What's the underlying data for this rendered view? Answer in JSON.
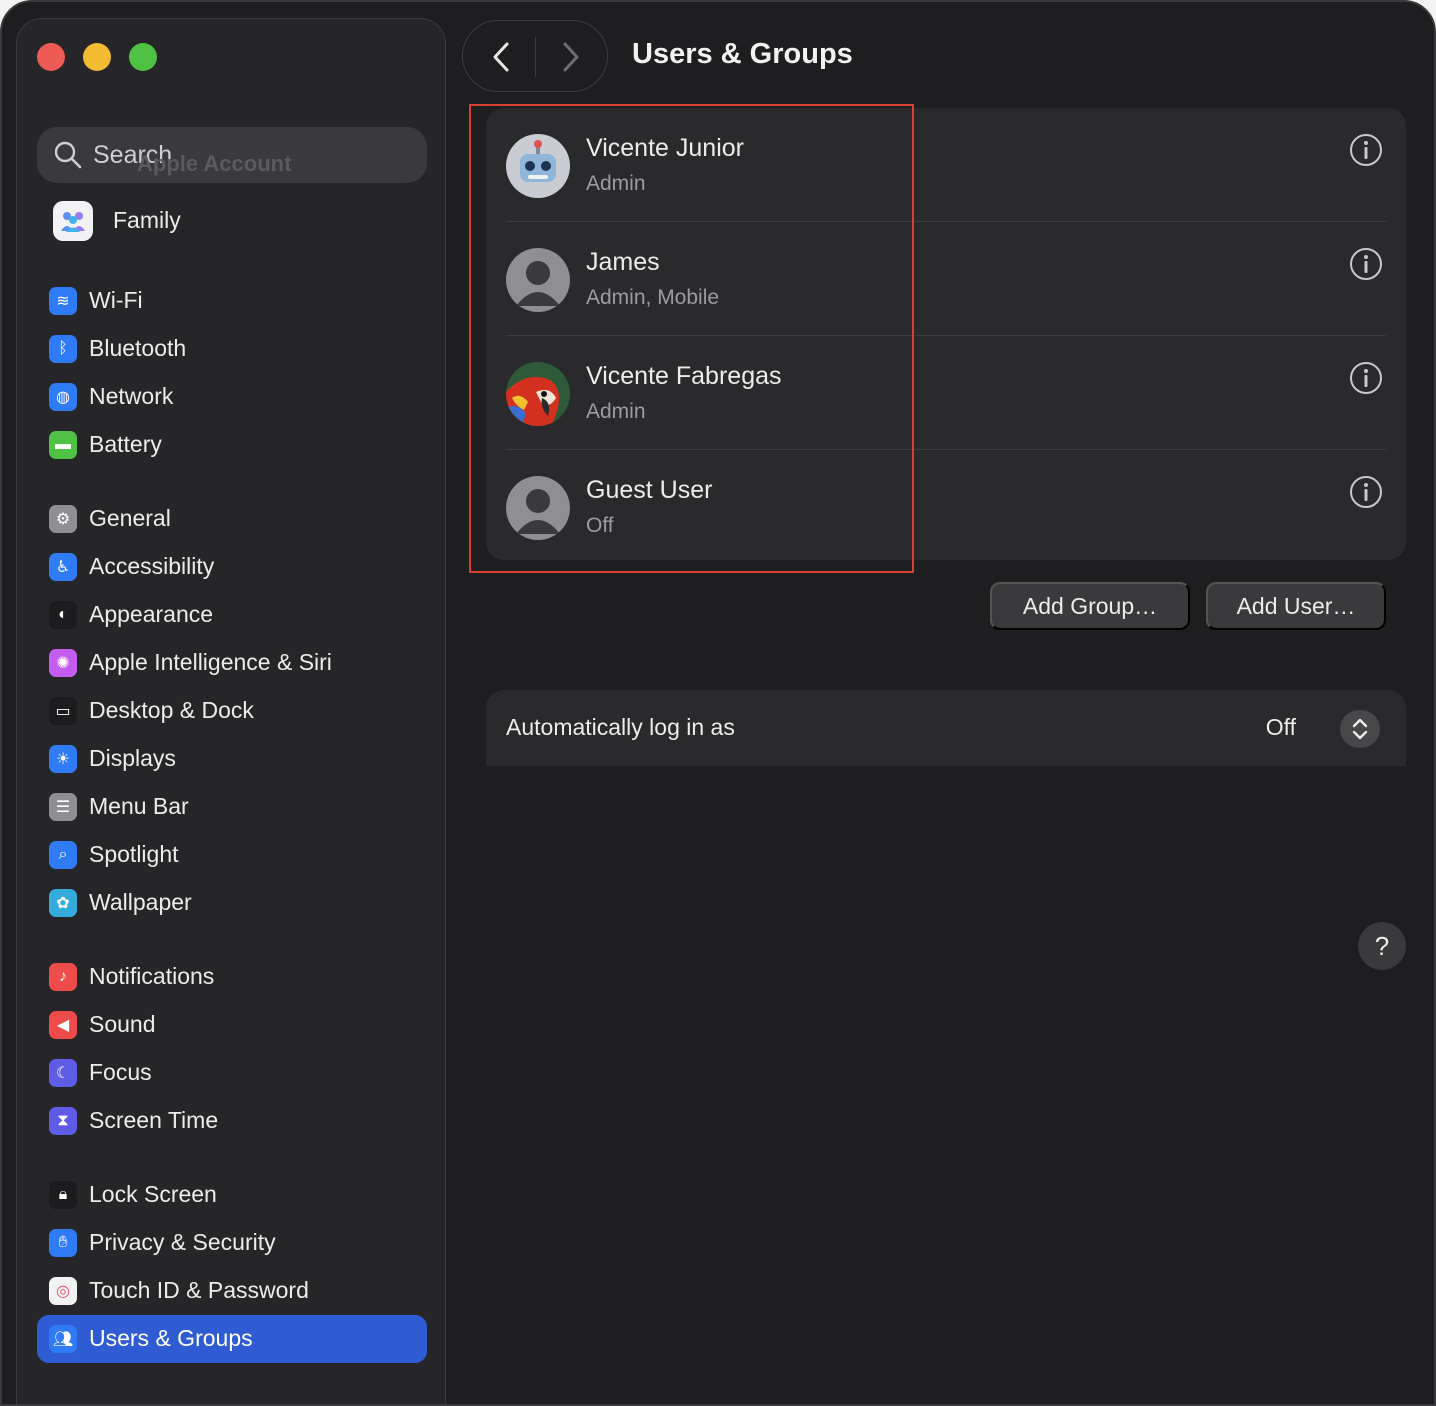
{
  "window": {
    "title": "Users & Groups"
  },
  "search": {
    "placeholder": "Search",
    "ghost_text": "Apple Account"
  },
  "sidebar": {
    "family": {
      "label": "Family",
      "icon": "family-icon"
    },
    "items": [
      {
        "label": "Wi-Fi",
        "icon": "wifi-icon",
        "color": "#2f7bf5"
      },
      {
        "label": "Bluetooth",
        "icon": "bluetooth-icon",
        "color": "#2f7bf5"
      },
      {
        "label": "Network",
        "icon": "globe-icon",
        "color": "#2f7bf5"
      },
      {
        "label": "Battery",
        "icon": "battery-icon",
        "color": "#4fc245"
      },
      {
        "label": "General",
        "icon": "gear-icon",
        "color": "#8e8e93"
      },
      {
        "label": "Accessibility",
        "icon": "accessibility-icon",
        "color": "#2f7bf5"
      },
      {
        "label": "Appearance",
        "icon": "appearance-icon",
        "color": "#1c1c1e"
      },
      {
        "label": "Apple Intelligence & Siri",
        "icon": "siri-icon",
        "color": "#c45cf0"
      },
      {
        "label": "Desktop & Dock",
        "icon": "dock-icon",
        "color": "#1c1c1e"
      },
      {
        "label": "Displays",
        "icon": "sun-icon",
        "color": "#2f7bf5"
      },
      {
        "label": "Menu Bar",
        "icon": "menubar-icon",
        "color": "#8e8e93"
      },
      {
        "label": "Spotlight",
        "icon": "magnifier-icon",
        "color": "#2f7bf5"
      },
      {
        "label": "Wallpaper",
        "icon": "flower-icon",
        "color": "#35aadc"
      },
      {
        "label": "Notifications",
        "icon": "bell-icon",
        "color": "#ee4b4b"
      },
      {
        "label": "Sound",
        "icon": "speaker-icon",
        "color": "#ee4b4b"
      },
      {
        "label": "Focus",
        "icon": "moon-icon",
        "color": "#5e5ce6"
      },
      {
        "label": "Screen Time",
        "icon": "hourglass-icon",
        "color": "#5e5ce6"
      },
      {
        "label": "Lock Screen",
        "icon": "lock-icon",
        "color": "#1c1c1e"
      },
      {
        "label": "Privacy & Security",
        "icon": "hand-icon",
        "color": "#2f7bf5"
      },
      {
        "label": "Touch ID & Password",
        "icon": "fingerprint-icon",
        "color": "#f2f2f4"
      },
      {
        "label": "Users & Groups",
        "icon": "users-icon",
        "color": "#2f7bf5",
        "active": true
      }
    ]
  },
  "users": [
    {
      "name": "Vicente Junior",
      "role": "Admin",
      "avatar": "robot-avatar"
    },
    {
      "name": "James",
      "role": "Admin, Mobile",
      "avatar": "default-avatar"
    },
    {
      "name": "Vicente Fabregas",
      "role": "Admin",
      "avatar": "parrot-avatar"
    },
    {
      "name": "Guest User",
      "role": "Off",
      "avatar": "default-avatar"
    }
  ],
  "buttons": {
    "add_group": "Add Group…",
    "add_user": "Add User…"
  },
  "autologin": {
    "label": "Automatically log in as",
    "value": "Off"
  },
  "help": {
    "label": "?"
  },
  "colors": {
    "accent": "#2f5bd3",
    "highlight": "#d9412f"
  }
}
